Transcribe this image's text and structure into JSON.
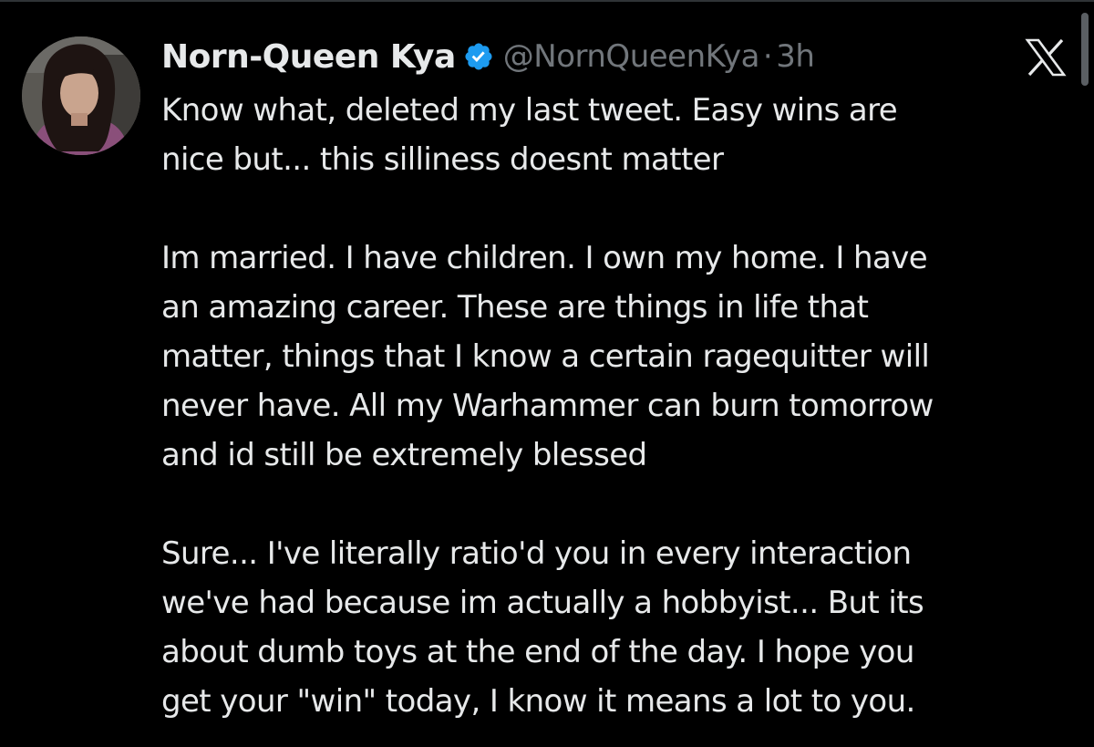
{
  "author": {
    "display_name": "Norn-Queen Kya",
    "handle": "@NornQueenKya",
    "separator": "·",
    "time": "3h",
    "verified": true
  },
  "platform": {
    "logo": "x-logo-icon"
  },
  "tweet": {
    "paragraphs": [
      [
        "Know what, deleted my last tweet. Easy wins are",
        "nice but... this silliness doesnt matter"
      ],
      [
        "Im married. I have children. I own my home. I have",
        "an amazing career. These are things in life that",
        "matter, things that I know a certain ragequitter will",
        "never have. All my Warhammer can burn tomorrow",
        "and id still be extremely blessed"
      ],
      [
        "Sure... I've literally ratio'd you in every interaction",
        "we've had because im actually a hobbyist... But its",
        "about dumb toys at the end of the day. I hope you",
        "get your \"win\" today, I know it means a lot to you."
      ]
    ]
  },
  "colors": {
    "background": "#000000",
    "text_primary": "#e7e9ea",
    "text_secondary": "#71767b",
    "verified_blue": "#1d9bf0"
  }
}
